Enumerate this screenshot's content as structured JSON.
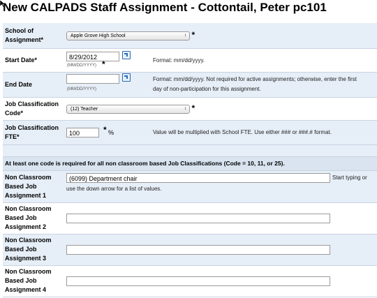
{
  "title": "New CALPADS Staff Assignment - Cottontail, Peter   pc101",
  "fields": {
    "school": {
      "label_line1": "School of",
      "label_line2": "Assignment*",
      "value": "Apple Grove High School",
      "required_mark": "*"
    },
    "start_date": {
      "label": "Start Date*",
      "value": "8/29/2012",
      "format_hint": "(MM/DD/YYYY)",
      "required_mark": "*",
      "note": "Format: mm/dd/yyyy."
    },
    "end_date": {
      "label": "End Date",
      "value": "",
      "format_hint": "(MM/DD/YYYY)",
      "note_line1": "Format: mm/dd/yyyy. Not required for active assignments; otherwise, enter the first",
      "note_line2": "day of non-participation for this assignment."
    },
    "job_class_code": {
      "label_line1": "Job Classification",
      "label_line2": "Code*",
      "value": "(12) Teacher",
      "required_mark": "*"
    },
    "job_class_fte": {
      "label_line1": "Job Classification",
      "label_line2": "FTE*",
      "value": "100",
      "required_mark": "*",
      "unit": "%",
      "note": "Value will be multiplied with School FTE. Use either ### or ###.# format."
    }
  },
  "non_classroom": {
    "section_header": "At least one code is required for all non classroom based Job Classifications (Code = 10, 11, or 25).",
    "label_line1": "Non Classroom",
    "label_line2": "Based Job",
    "assignments": [
      {
        "label_line3": "Assignment 1",
        "value": "(6099) Department chair",
        "help_inline": "Start typing or",
        "help_line2": "use the down arrow for a list of values."
      },
      {
        "label_line3": "Assignment 2",
        "value": ""
      },
      {
        "label_line3": "Assignment 3",
        "value": ""
      },
      {
        "label_line3": "Assignment 4",
        "value": ""
      }
    ]
  },
  "icons": {
    "calendar": "calendar-icon",
    "select_arrows": "select-arrows-icon"
  }
}
